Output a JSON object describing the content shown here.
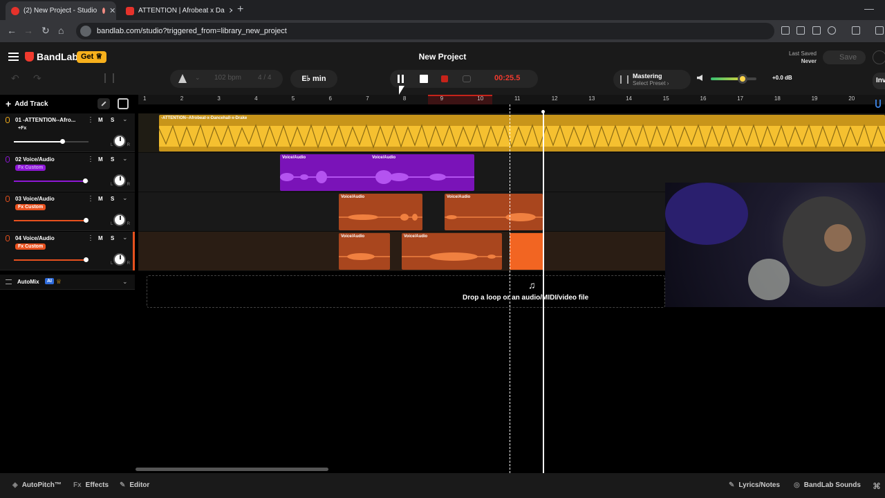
{
  "browser": {
    "tabs": [
      {
        "title": "(2) New Project - Studio",
        "close": "✕"
      },
      {
        "title": "ATTENTION | Afrobeat x Da",
        "close": "✕"
      }
    ],
    "new_tab": "+",
    "window_minimize": "—",
    "nav": {
      "back": "←",
      "forward": "→",
      "reload": "↻",
      "home": "⌂"
    },
    "url": "bandlab.com/studio?triggered_from=library_new_project"
  },
  "header": {
    "brand": "BandLab",
    "get_label": "Get ♕",
    "project_title": "New Project",
    "last_saved_label": "Last Saved",
    "last_saved_value": "Never",
    "save_label": "Save",
    "invite_label": "Inv"
  },
  "toolbar": {
    "undo": "↶",
    "redo": "↷",
    "tempo_caret": "⌄",
    "bpm": "102 bpm",
    "time_signature": "4 / 4",
    "key": "E♭ min",
    "time": "00:25.5",
    "mastering_title": "Mastering",
    "mastering_sub": "Select Preset ›",
    "volume_level": 0.7,
    "volume_db": "+0.0 dB"
  },
  "ruler": {
    "bars": [
      "1",
      "2",
      "3",
      "4",
      "5",
      "6",
      "7",
      "8",
      "9",
      "10",
      "11",
      "12",
      "13",
      "14",
      "15",
      "16",
      "17",
      "18",
      "19",
      "20"
    ]
  },
  "track_panel": {
    "add_track": "Add Track",
    "add_icon": "+",
    "tracks": [
      {
        "name": "01 -ATTENTION--Afro...",
        "fx": "+Fx",
        "mute": "M",
        "solo": "S",
        "volume": 0.65,
        "pan_l": "L",
        "pan_r": "R",
        "color": "#f7b01c"
      },
      {
        "name": "02 Voice/Audio",
        "fx": "Fx Custom",
        "mute": "M",
        "solo": "S",
        "volume": 0.95,
        "pan_l": "L",
        "pan_r": "R",
        "color": "#8e17d6"
      },
      {
        "name": "03 Voice/Audio",
        "fx": "Fx Custom",
        "mute": "M",
        "solo": "S",
        "volume": 0.96,
        "pan_l": "L",
        "pan_r": "R",
        "color": "#e8511e"
      },
      {
        "name": "04 Voice/Audio",
        "fx": "Fx Custom",
        "mute": "M",
        "solo": "S",
        "volume": 0.96,
        "pan_l": "L",
        "pan_r": "R",
        "color": "#e8511e"
      }
    ],
    "more_icon": "⋮",
    "caret": "⌄",
    "automix_label": "AutoMix",
    "ai_badge": "AI",
    "crown": "♕"
  },
  "clips": {
    "track1": "-ATTENTION--Afrobeat-x-Dancehall-x-Drake",
    "voice": "Voice/Audio"
  },
  "drop_zone": {
    "text": "Drop a loop or an audio/MIDI/video file",
    "icon": "♫"
  },
  "bottom_bar": {
    "autopitch": "AutoPitch™",
    "effects": "Effects",
    "effects_icon": "Fx",
    "editor": "Editor",
    "lyrics": "Lyrics/Notes",
    "sounds": "BandLab Sounds",
    "cmd": "⌘"
  },
  "colors": {
    "accent": "#f03a2e",
    "gold": "#f7b01c",
    "purple": "#8e17d6",
    "orange": "#e8511e"
  }
}
